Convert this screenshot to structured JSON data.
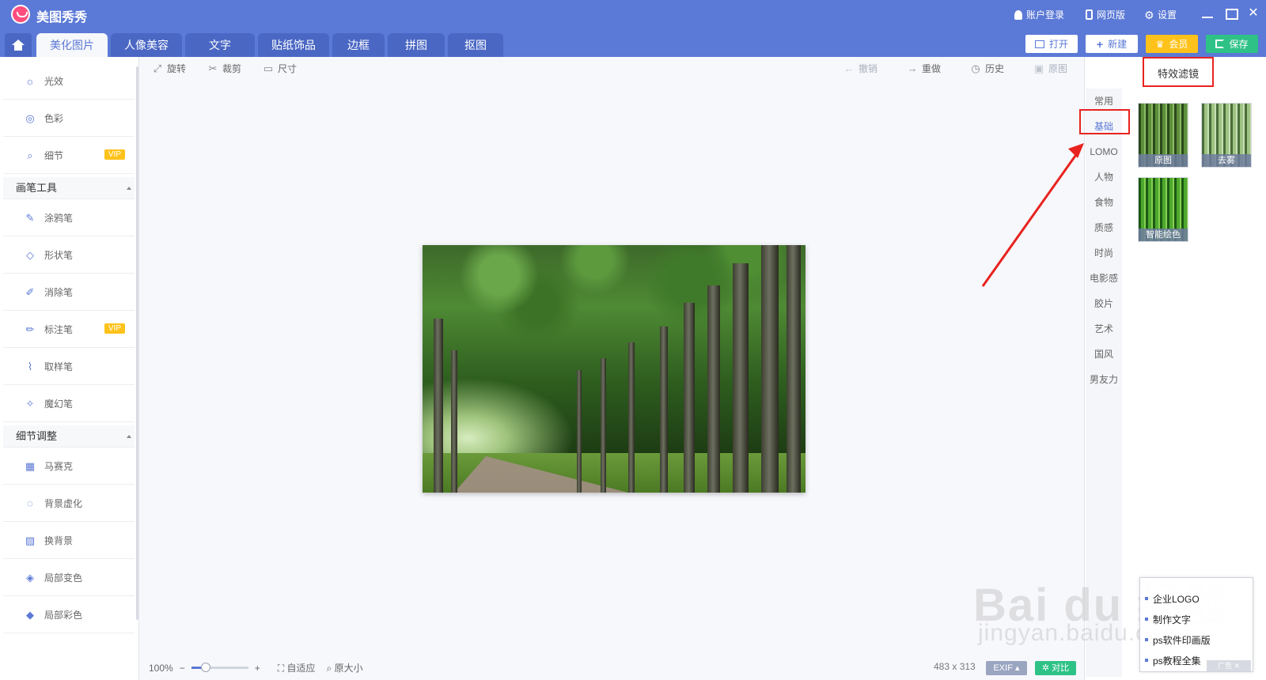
{
  "app": {
    "title": "美图秀秀"
  },
  "titlebar": {
    "login": "账户登录",
    "web": "网页版",
    "settings": "设置"
  },
  "tabs": [
    {
      "label": "美化图片"
    },
    {
      "label": "人像美容"
    },
    {
      "label": "文字"
    },
    {
      "label": "贴纸饰品"
    },
    {
      "label": "边框"
    },
    {
      "label": "拼图"
    },
    {
      "label": "抠图"
    }
  ],
  "actions": {
    "open": "打开",
    "new": "新建",
    "vip": "会员",
    "save": "保存"
  },
  "sidebar": {
    "top_items": [
      {
        "label": "光效"
      },
      {
        "label": "色彩"
      },
      {
        "label": "细节",
        "badge": "VIP"
      }
    ],
    "brush_section": "画笔工具",
    "brush_items": [
      {
        "label": "涂鸦笔"
      },
      {
        "label": "形状笔"
      },
      {
        "label": "消除笔"
      },
      {
        "label": "标注笔",
        "badge": "VIP"
      },
      {
        "label": "取样笔"
      },
      {
        "label": "魔幻笔"
      }
    ],
    "detail_section": "细节调整",
    "detail_items": [
      {
        "label": "马赛克"
      },
      {
        "label": "背景虚化"
      },
      {
        "label": "换背景"
      },
      {
        "label": "局部变色"
      },
      {
        "label": "局部彩色"
      }
    ]
  },
  "toolbar": {
    "rotate": "旋转",
    "crop": "裁剪",
    "size": "尺寸",
    "undo": "撤销",
    "redo": "重做",
    "history": "历史",
    "original": "原图"
  },
  "status": {
    "zoom": "100%",
    "zoom_level": 0.25,
    "fit": "自适应",
    "actual_size": "原大小",
    "dimensions": "483 x 313",
    "exif": "EXIF",
    "compare": "对比"
  },
  "right_panel": {
    "header": "特效滤镜",
    "categories": [
      "常用",
      "基础",
      "LOMO",
      "人物",
      "食物",
      "质感",
      "时尚",
      "电影感",
      "胶片",
      "艺术",
      "国风",
      "男友力"
    ],
    "selected_category": "基础",
    "filters": [
      {
        "label": "原图"
      },
      {
        "label": "去雾"
      },
      {
        "label": "智能绘色"
      }
    ]
  },
  "watermark": {
    "main": "Bai du 经验",
    "sub": "jingyan.baidu.com"
  },
  "ad_popup": {
    "items": [
      "企业LOGO",
      "制作文字",
      "ps软件印画版",
      "ps教程全集"
    ],
    "tag": "广告"
  },
  "colors": {
    "brand": "#5b79d6",
    "vip": "#ffc21a",
    "save": "#2ec287",
    "annotation": "#e8231f"
  }
}
